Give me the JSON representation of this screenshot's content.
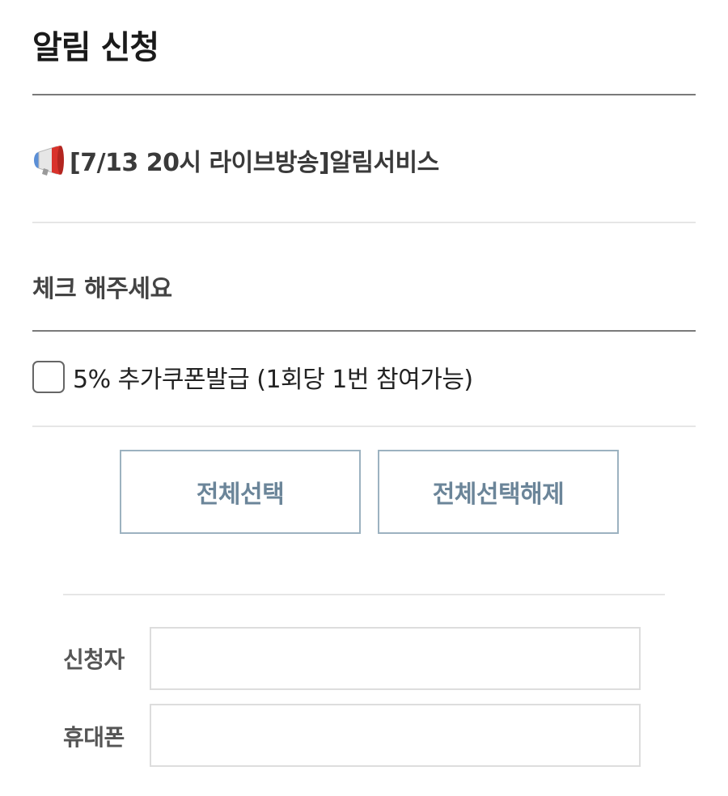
{
  "page": {
    "title": "알림 신청"
  },
  "event": {
    "icon": "megaphone-icon",
    "title": "[7/13 20시 라이브방송]알림서비스"
  },
  "section": {
    "label": "체크 해주세요"
  },
  "options": [
    {
      "label": "5% 추가쿠폰발급 (1회당 1번 참여가능)",
      "checked": false
    }
  ],
  "buttons": {
    "select_all": "전체선택",
    "deselect_all": "전체선택해제"
  },
  "form": {
    "applicant": {
      "label": "신청자",
      "value": "",
      "placeholder": ""
    },
    "phone": {
      "label": "휴대폰",
      "value": "",
      "placeholder": ""
    }
  },
  "colors": {
    "button_border": "#9cb2c0",
    "button_text": "#6b8599",
    "megaphone": "#d9322b"
  }
}
